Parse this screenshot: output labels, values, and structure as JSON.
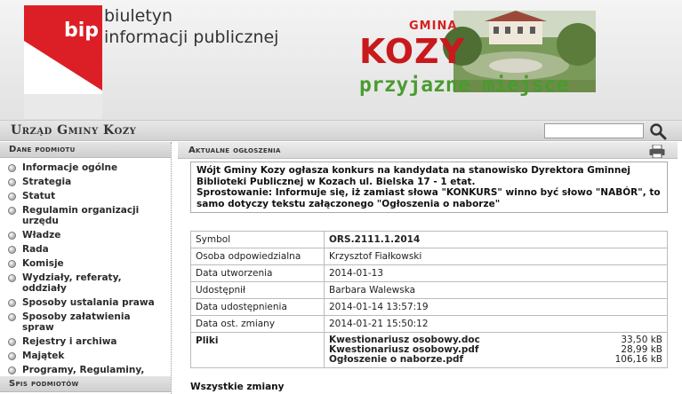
{
  "header": {
    "bip_badge": "bip",
    "bip_line1": "biuletyn",
    "bip_line2": "informacji publicznej",
    "gmina": "GMINA",
    "kozy": "KOZY",
    "slogan": "przyjazne miejsce"
  },
  "titlebar": {
    "title": "Urząd Gminy Kozy",
    "search_placeholder": ""
  },
  "sidebar": {
    "dane_header": "Dane podmiotu",
    "items": [
      {
        "label": "Informacje ogólne"
      },
      {
        "label": "Strategia"
      },
      {
        "label": "Statut"
      },
      {
        "label": "Regulamin organizacji urzędu"
      },
      {
        "label": "Władze"
      },
      {
        "label": "Rada"
      },
      {
        "label": "Komisje"
      },
      {
        "label": "Wydziały, referaty, oddziały"
      },
      {
        "label": "Sposoby ustalania prawa"
      },
      {
        "label": "Sposoby załatwienia spraw"
      },
      {
        "label": "Rejestry i archiwa"
      },
      {
        "label": "Majątek"
      },
      {
        "label": "Programy, Regulaminy, Budżet, Inne"
      }
    ],
    "spis_header": "Spis podmiotów"
  },
  "main": {
    "header": "Aktualne ogłoszenia",
    "announcement": {
      "line1": "Wójt Gminy Kozy ogłasza konkurs na kandydata na stanowisko Dyrektora Gminnej Biblioteki Publicznej w Kozach ul. Bielska 17 - 1 etat.",
      "line2": "Sprostowanie: Informuje się, iż zamiast słowa \"KONKURS\" winno być słowo \"NABÓR\", to samo dotyczy tekstu załączonego \"Ogłoszenia o naborze\""
    },
    "meta": [
      {
        "key": "Symbol",
        "value": "ORS.2111.1.2014",
        "bold": true
      },
      {
        "key": "Osoba odpowiedzialna",
        "value": "Krzysztof Fiałkowski",
        "bold": false
      },
      {
        "key": "Data utworzenia",
        "value": "2014-01-13",
        "bold": false
      },
      {
        "key": "Udostępnił",
        "value": "Barbara Walewska",
        "bold": false
      },
      {
        "key": "Data udostępnienia",
        "value": "2014-01-14 13:57:19",
        "bold": false
      },
      {
        "key": "Data ost. zmiany",
        "value": "2014-01-21 15:50:12",
        "bold": false
      }
    ],
    "files_label": "Pliki",
    "files": [
      {
        "name": "Kwestionariusz osobowy.doc",
        "size": "33,50 kB"
      },
      {
        "name": "Kwestionariusz osobowy.pdf",
        "size": "28,99 kB"
      },
      {
        "name": "Ogłoszenie o naborze.pdf",
        "size": "106,16 kB"
      }
    ],
    "all_changes": "Wszystkie zmiany"
  },
  "colors": {
    "bip_red": "#dc1f26",
    "kozy_red": "#c8191c",
    "slogan_green": "#4a9b2f"
  }
}
